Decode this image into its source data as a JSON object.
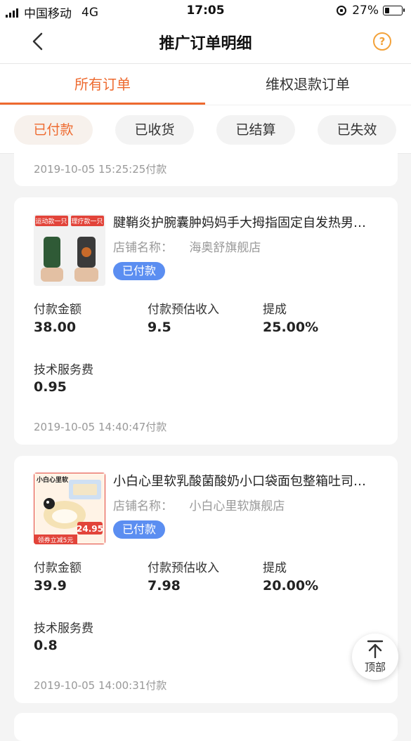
{
  "status_bar": {
    "carrier": "中国移动",
    "network": "4G",
    "time": "17:05",
    "battery": "27%"
  },
  "nav": {
    "title": "推广订单明细",
    "help": "?"
  },
  "tabs": [
    {
      "label": "所有订单",
      "active": true
    },
    {
      "label": "维权退款订单",
      "active": false
    }
  ],
  "filters": [
    {
      "label": "已付款",
      "active": true
    },
    {
      "label": "已收货",
      "active": false
    },
    {
      "label": "已结算",
      "active": false
    },
    {
      "label": "已失效",
      "active": false
    }
  ],
  "partial_card": {
    "date": "2019-10-05 15:25:25付款"
  },
  "orders": [
    {
      "title": "腱鞘炎护腕囊肿妈妈手大拇指固定自发热男…",
      "shop_label": "店铺名称：",
      "shop_name": "海奥舒旗舰店",
      "status": "已付款",
      "thumb_tags": [
        "运动款一只",
        "理疗款一只"
      ],
      "metrics": [
        {
          "label": "付款金额",
          "value": "38.00"
        },
        {
          "label": "付款预估收入",
          "value": "9.5"
        },
        {
          "label": "提成",
          "value": "25.00%"
        },
        {
          "label": "技术服务费",
          "value": "0.95"
        }
      ],
      "date": "2019-10-05 14:40:47付款"
    },
    {
      "title": "小白心里软乳酸菌酸奶小口袋面包整箱吐司…",
      "shop_label": "店铺名称：",
      "shop_name": "小白心里软旗舰店",
      "status": "已付款",
      "thumb_tags": [
        "小白心里软",
        "领券立减5元",
        "24.95"
      ],
      "metrics": [
        {
          "label": "付款金额",
          "value": "39.9"
        },
        {
          "label": "付款预估收入",
          "value": "7.98"
        },
        {
          "label": "提成",
          "value": "20.00%"
        },
        {
          "label": "技术服务费",
          "value": "0.8"
        }
      ],
      "date": "2019-10-05 14:00:31付款"
    }
  ],
  "top_button": {
    "label": "顶部"
  },
  "colors": {
    "accent": "#ee6a2f",
    "badge": "#5b8ef1",
    "help": "#f3a23a"
  }
}
